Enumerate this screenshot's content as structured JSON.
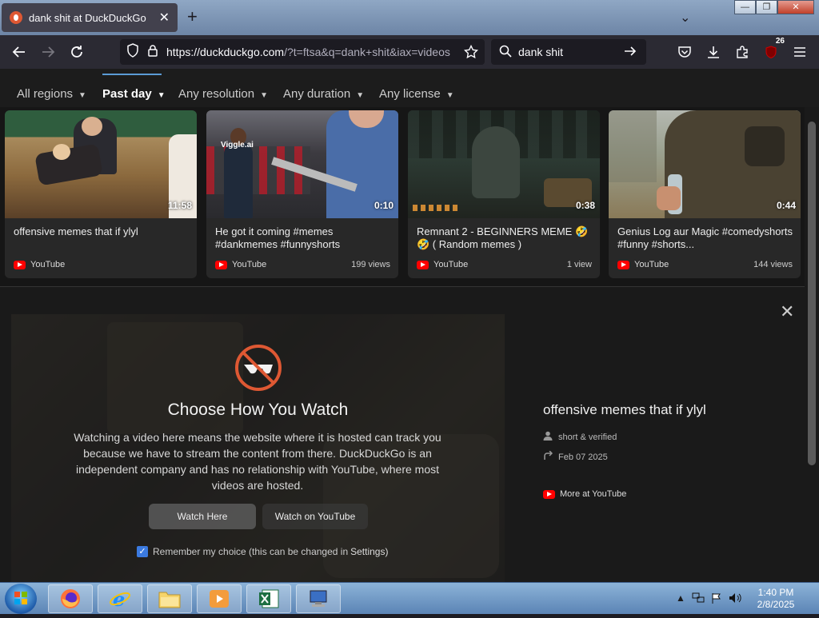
{
  "tab": {
    "title": "dank shit at DuckDuckGo",
    "close": "✕"
  },
  "tabstrip": {
    "new_tab": "+",
    "list_tabs": "⌄"
  },
  "window_controls": {
    "minimize": "—",
    "maximize": "❐",
    "close": "✕"
  },
  "nav": {
    "url_host": "https://duckduckgo.com",
    "url_rest": "/?t=ftsa&q=dank+shit&iax=videos",
    "search_query": "dank shit",
    "extensions_badge": "26"
  },
  "filters": [
    {
      "label": "All regions",
      "active": false
    },
    {
      "label": "Past day",
      "active": true
    },
    {
      "label": "Any resolution",
      "active": false
    },
    {
      "label": "Any duration",
      "active": false
    },
    {
      "label": "Any license",
      "active": false
    }
  ],
  "videos": [
    {
      "title": "offensive memes that if ylyl",
      "duration": "11:58",
      "source": "YouTube",
      "views": ""
    },
    {
      "title": "He got it coming #memes #dankmemes #funnyshorts",
      "duration": "0:10",
      "source": "YouTube",
      "views": "199 views",
      "watermark": "Viggle.ai"
    },
    {
      "title": "Remnant 2 - BEGINNERS MEME 🤣🤣 ( Random memes )",
      "duration": "0:38",
      "source": "YouTube",
      "views": "1 view"
    },
    {
      "title": "Genius Log aur Magic #comedyshorts #funny #shorts...",
      "duration": "0:44",
      "source": "YouTube",
      "views": "144 views"
    }
  ],
  "player": {
    "heading": "Choose How You Watch",
    "body": "Watching a video here means the website where it is hosted can track you because we have to stream the content from there. DuckDuckGo is an independent company and has no relationship with YouTube, where most videos are hosted.",
    "watch_here": "Watch Here",
    "watch_youtube": "Watch on YouTube",
    "remember_text": "Remember my choice (this can be changed in",
    "remember_link": "Settings)"
  },
  "detail": {
    "title": "offensive memes that if ylyl",
    "channel": "short & verified",
    "date": "Feb 07 2025",
    "more_link": "More at YouTube",
    "close": "✕"
  },
  "taskbar": {
    "time": "1:40 PM",
    "date": "2/8/2025"
  }
}
